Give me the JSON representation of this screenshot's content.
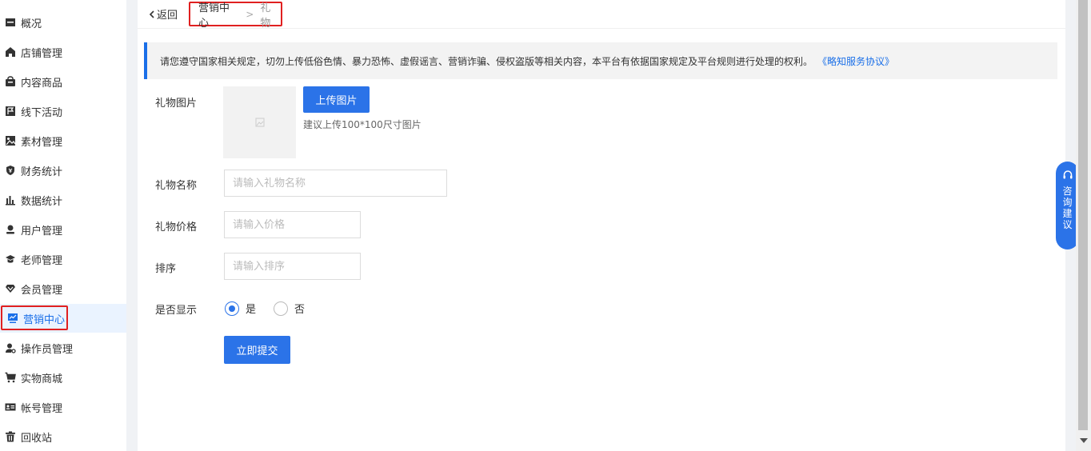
{
  "sidebar": {
    "items": [
      {
        "label": "概况",
        "icon": "overview-icon"
      },
      {
        "label": "店铺管理",
        "icon": "store-icon"
      },
      {
        "label": "内容商品",
        "icon": "bag-icon"
      },
      {
        "label": "线下活动",
        "icon": "flag-icon"
      },
      {
        "label": "素材管理",
        "icon": "image-icon"
      },
      {
        "label": "财务统计",
        "icon": "finance-icon"
      },
      {
        "label": "数据统计",
        "icon": "bar-chart-icon"
      },
      {
        "label": "用户管理",
        "icon": "user-icon"
      },
      {
        "label": "老师管理",
        "icon": "graduation-cap-icon"
      },
      {
        "label": "会员管理",
        "icon": "vip-diamond-icon"
      },
      {
        "label": "营销中心",
        "icon": "marketing-icon"
      },
      {
        "label": "操作员管理",
        "icon": "operator-icon"
      },
      {
        "label": "实物商城",
        "icon": "cart-icon"
      },
      {
        "label": "帐号管理",
        "icon": "id-card-icon"
      },
      {
        "label": "回收站",
        "icon": "trash-icon"
      }
    ],
    "active_index": 10,
    "accent": "#1a6fe8"
  },
  "topbar": {
    "back_label": "返回",
    "breadcrumb": [
      "营销中心",
      "礼物"
    ]
  },
  "notice": {
    "text": "请您遵守国家相关规定，切勿上传低俗色情、暴力恐怖、虚假谣言、营销诈骗、侵权盗版等相关内容，本平台有依据国家规定及平台规则进行处理的权利。",
    "link": "《略知服务协议》"
  },
  "form": {
    "image_label": "礼物图片",
    "upload_button": "上传图片",
    "upload_hint": "建议上传100*100尺寸图片",
    "name_label": "礼物名称",
    "name_placeholder": "请输入礼物名称",
    "name_value": "",
    "price_label": "礼物价格",
    "price_placeholder": "请输入价格",
    "price_value": "",
    "sort_label": "排序",
    "sort_placeholder": "请输入排序",
    "sort_value": "",
    "show_label": "是否显示",
    "show_options": [
      "是",
      "否"
    ],
    "show_selected": "是",
    "submit_button": "立即提交"
  },
  "consult": {
    "label": "咨询建议",
    "icon": "headset-icon"
  },
  "colors": {
    "primary": "#2b73e8",
    "highlight_border": "#e02020"
  }
}
